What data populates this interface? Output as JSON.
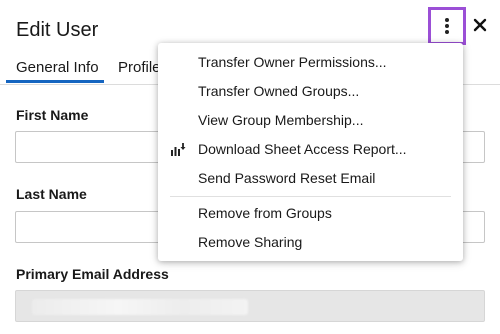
{
  "dialog": {
    "title": "Edit User"
  },
  "header_actions": {
    "more_icon": "vertical-ellipsis-icon",
    "close_icon": "close-x-icon",
    "close_glyph": "✕"
  },
  "tabs": [
    {
      "label": "General Info",
      "active": true
    },
    {
      "label": "Profile",
      "active": false
    }
  ],
  "form": {
    "first_name_label": "First Name",
    "first_name_value": "",
    "last_name_label": "Last Name",
    "last_name_value": "",
    "email_label": "Primary Email Address",
    "email_value": ""
  },
  "menu": {
    "items": [
      {
        "label": "Transfer Owner Permissions...",
        "icon": null
      },
      {
        "label": "Transfer Owned Groups...",
        "icon": null
      },
      {
        "label": "View Group Membership...",
        "icon": null
      },
      {
        "label": "Download Sheet Access Report...",
        "icon": "download-report-icon"
      },
      {
        "label": "Send Password Reset Email",
        "icon": null
      },
      {
        "label": "Remove from Groups",
        "icon": null
      },
      {
        "label": "Remove Sharing",
        "icon": null
      }
    ]
  },
  "colors": {
    "accent_tab": "#1565c0",
    "highlight_border": "#9b4fd6",
    "disabled_field": "#e6e6e6"
  }
}
